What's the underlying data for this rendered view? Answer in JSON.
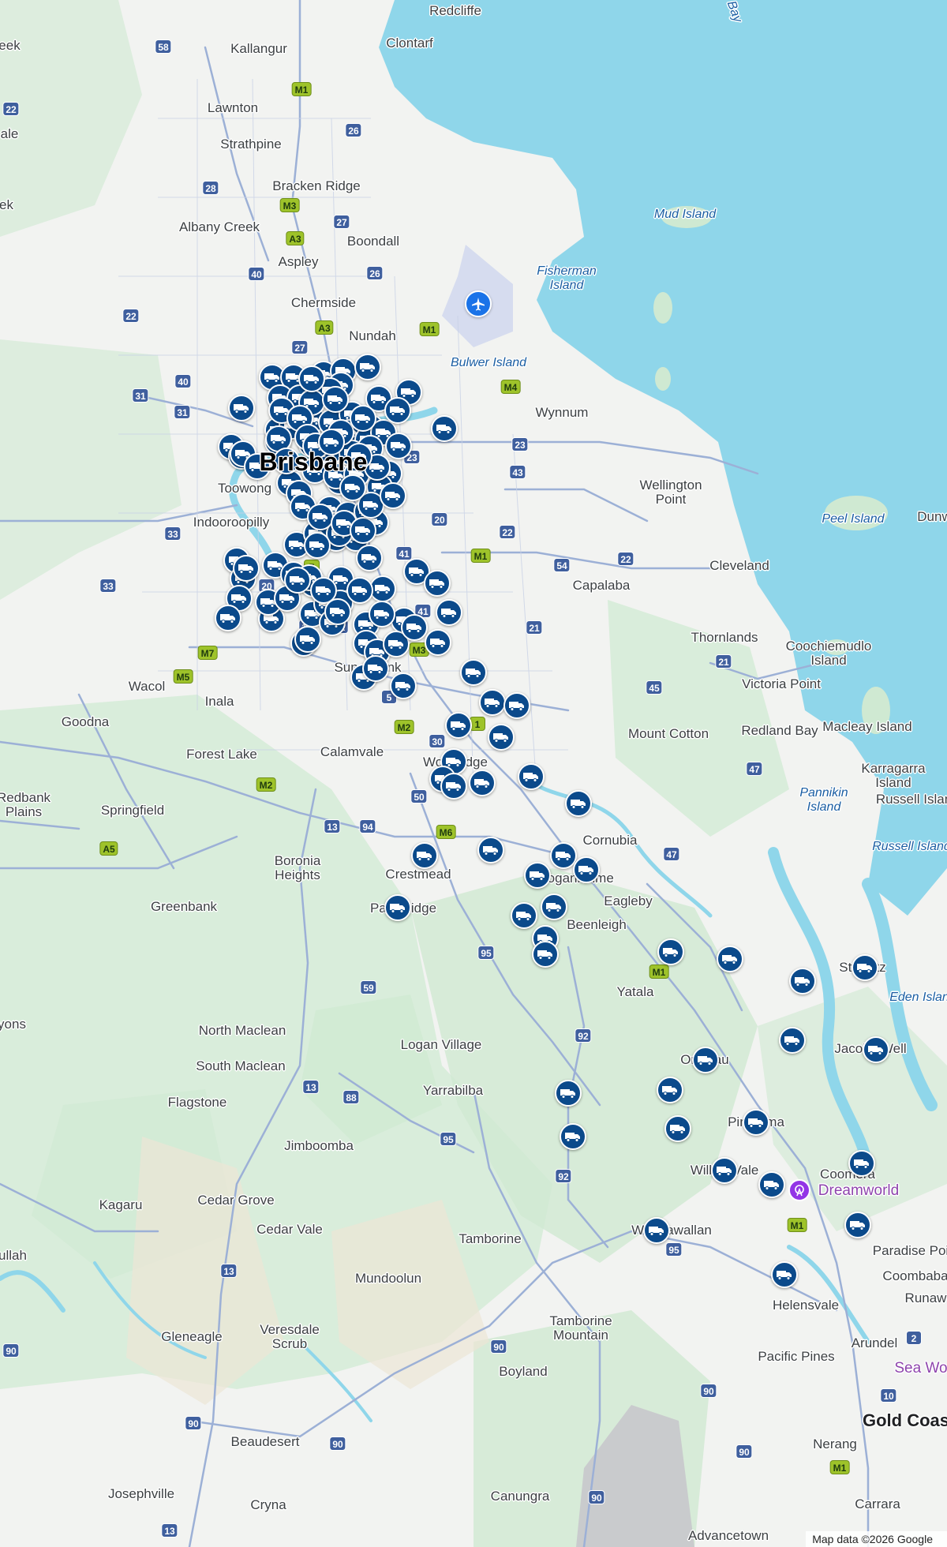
{
  "map": {
    "attribution": "Map data ©2026 Google",
    "colors": {
      "water": "#8fd6ea",
      "land": "#f2f3f1",
      "park": "#cfe9d2",
      "road": "#8ea6cf",
      "marker": "#0b4a8b"
    },
    "labels": {
      "redcliffe": "Redcliffe",
      "kallangur": "Kallangur",
      "clontarf": "Clontarf",
      "lawnton": "Lawnton",
      "strathpine": "Strathpine",
      "bracken_ridge": "Bracken Ridge",
      "mud_island": "Mud Island",
      "albany_creek": "Albany Creek",
      "boondall": "Boondall",
      "aspley": "Aspley",
      "fisherman_island": "Fisherman\nIsland",
      "chermside": "Chermside",
      "nundah": "Nundah",
      "bulwer_island": "Bulwer Island",
      "wynnum": "Wynnum",
      "brisbane": "Brisbane",
      "toowong": "Toowong",
      "wellington_point": "Wellington\nPoint",
      "indooroopilly": "Indooroopilly",
      "peel_island": "Peel Island",
      "dunwich": "Dunw",
      "cleveland": "Cleveland",
      "capalaba": "Capalaba",
      "thornlands": "Thornlands",
      "coochiemudlo_island": "Coochiemudlo\nIsland",
      "victoria_point": "Victoria Point",
      "wacol": "Wacol",
      "inala": "Inala",
      "goodna": "Goodna",
      "mount_cotton": "Mount Cotton",
      "redland_bay": "Redland Bay",
      "macleay_island": "Macleay Island",
      "forest_lake": "Forest Lake",
      "calamvale": "Calamvale",
      "sunnybank": "Sunnybank",
      "woodridge": "Woodridge",
      "karragarra_island": "Karragarra\nIsland",
      "redbank_plains": "Redbank\nPlains",
      "springfield": "Springfield",
      "pannikin_island": "Pannikin\nIsland",
      "russell_island": "Russell Island",
      "russell_island_2": "Russell Islan",
      "cornubia": "Cornubia",
      "boronia_heights": "Boronia\nHeights",
      "crestmead": "Crestmead",
      "loganholme": "Loganholme",
      "eagleby": "Eagleby",
      "greenbank": "Greenbank",
      "park_ridge": "Park Ridge",
      "beenleigh": "Beenleigh",
      "yatala": "Yatala",
      "steiglitz": "Steiglitz",
      "eden_island": "Eden Islan",
      "north_maclean": "North Maclean",
      "logan_village": "Logan Village",
      "jacobs_well": "Jacobs Well",
      "ormeau": "Ormeau",
      "south_maclean": "South Maclean",
      "yarrabilba": "Yarrabilba",
      "flagstone": "Flagstone",
      "pimpama": "Pimpama",
      "jimboomba": "Jimboomba",
      "willow_vale": "Willow Vale",
      "coomera": "Coomera",
      "dreamworld": "Dreamworld",
      "kagaru": "Kagaru",
      "cedar_grove": "Cedar Grove",
      "cedar_vale": "Cedar Vale",
      "wongawallan": "Wongawallan",
      "tamborine": "Tamborine",
      "paradise_point": "Paradise Poi",
      "coombabah": "Coombaba",
      "mundoolun": "Mundoolun",
      "runaway": "Runaw",
      "helensvale": "Helensvale",
      "tamborine_mountain": "Tamborine\nMountain",
      "gleneagle": "Gleneagle",
      "veresdale_scrub": "Veresdale\nScrub",
      "arundel": "Arundel",
      "boyland": "Boyland",
      "pacific_pines": "Pacific Pines",
      "sea_world": "Sea Wo",
      "gold_coast": "Gold Coas",
      "beaudesert": "Beaudesert",
      "nerang": "Nerang",
      "josephville": "Josephville",
      "canungra": "Canungra",
      "cryna": "Cryna",
      "carrara": "Carrara",
      "advancetown": "Advancetown",
      "eek1": "eek",
      "ale": "ale",
      "ek2": "ek",
      "yons": "yons",
      "ullah": "ullah",
      "bay": "Bay"
    },
    "routes": {
      "r58": "58",
      "m1a": "M1",
      "r22a": "22",
      "r26a": "26",
      "r28": "28",
      "m3a": "M3",
      "r27a": "27",
      "a3a": "A3",
      "r40a": "40",
      "r26b": "26",
      "r22b": "22",
      "a3b": "A3",
      "m1b": "M1",
      "r27b": "27",
      "r40b": "40",
      "r31a": "31",
      "r31b": "31",
      "m4": "M4",
      "r23a": "23",
      "r23b": "23",
      "r43": "43",
      "r20a": "20",
      "r33a": "33",
      "r22c": "22",
      "m1c": "M1",
      "r54": "54",
      "r22d": "22",
      "r33b": "33",
      "r20b": "20",
      "r41a": "41",
      "r41b": "41",
      "r13a": "13",
      "r11": "11",
      "r21a": "21",
      "r7": "7",
      "m7": "M7",
      "m3b": "M3",
      "r5": "5",
      "m5": "M5",
      "r21b": "21",
      "r45": "45",
      "m2a": "M2",
      "r30": "30",
      "r1": "1",
      "r47a": "47",
      "r50": "50",
      "m2b": "M2",
      "r13b": "13",
      "r94": "94",
      "m6": "M6",
      "r47b": "47",
      "a5": "A5",
      "r95a": "95",
      "m1d": "M1",
      "r59": "59",
      "r92a": "92",
      "r13c": "13",
      "r88": "88",
      "r95b": "95",
      "r92b": "92",
      "r95c": "95",
      "m1e": "M1",
      "r13d": "13",
      "r2": "2",
      "r90a": "90",
      "r90b": "90",
      "r90c": "90",
      "r10": "10",
      "r90d": "90",
      "r90e": "90",
      "r90f": "90",
      "m1f": "M1",
      "r13e": "13",
      "r90g": "90"
    },
    "icons": {
      "marker": "truck-icon",
      "airport": "airplane-icon",
      "poi": "ferris-wheel-icon"
    },
    "marker_count": 153
  }
}
